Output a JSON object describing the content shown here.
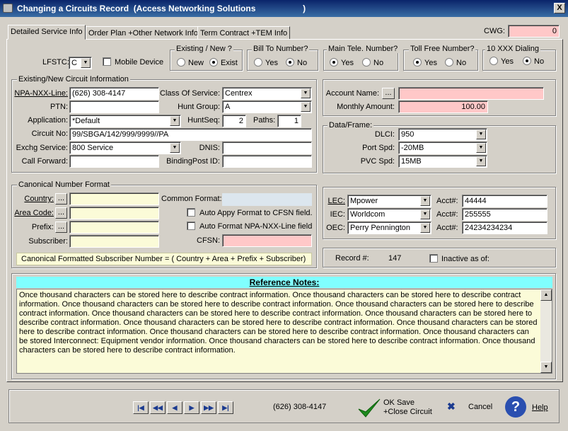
{
  "window": {
    "title": "Changing a Circuits Record  (Access Networking Solutions                    )",
    "close_label": "X"
  },
  "tabs": [
    {
      "label": "Detailed Service Info"
    },
    {
      "label": "Order Plan +Other Network Info"
    },
    {
      "label": "Term Contract +TEM Info"
    }
  ],
  "cwg": {
    "label": "CWG:",
    "value": "0"
  },
  "lfstc": {
    "label": "LFSTC:",
    "value": "C"
  },
  "mobile_device": {
    "label": "Mobile Device",
    "checked": false
  },
  "existing_new": {
    "title": "Existing / New ?",
    "options": [
      "New",
      "Exist"
    ],
    "selected": "Exist"
  },
  "bill_to_number": {
    "title": "Bill To Number?",
    "options": [
      "Yes",
      "No"
    ],
    "selected": "No"
  },
  "main_tele": {
    "title": "Main Tele. Number?",
    "options": [
      "Yes",
      "No"
    ],
    "selected": "Yes"
  },
  "toll_free": {
    "title": "Toll Free Number?",
    "options": [
      "Yes",
      "No"
    ],
    "selected": "Yes"
  },
  "ten_xxx": {
    "title": "10 XXX Dialing",
    "options": [
      "Yes",
      "No"
    ],
    "selected": "No"
  },
  "circuit_info": {
    "title": "Existing/New Circuit Information",
    "npa_label": "NPA-NXX-Line:",
    "npa_value": "(626) 308-4147",
    "ptn_label": "PTN:",
    "ptn_value": "",
    "application_label": "Application:",
    "application_value": "*Default",
    "circuit_no_label": "Circuit No:",
    "circuit_no_value": "99/SBGA/142/999/9999//PA",
    "exchg_label": "Exchg Service:",
    "exchg_value": "800 Service",
    "call_forward_label": "Call Forward:",
    "call_forward_value": "",
    "class_label": "Class Of Service:",
    "class_value": "Centrex",
    "hunt_group_label": "Hunt Group:",
    "hunt_group_value": "A",
    "huntseq_label": "HuntSeq:",
    "huntseq_value": "2",
    "paths_label": "Paths:",
    "paths_value": "1",
    "dnis_label": "DNIS:",
    "dnis_value": "",
    "bindingpost_label": "BindingPost ID:",
    "bindingpost_value": ""
  },
  "account": {
    "name_label": "Account Name:",
    "name_value": "",
    "monthly_label": "Monthly Amount:",
    "monthly_value": "100.00",
    "browse_label": "..."
  },
  "data_frame": {
    "title": "Data/Frame:",
    "dlci_label": "DLCI:",
    "dlci_value": "950",
    "port_label": "Port Spd:",
    "port_value": "-20MB",
    "pvc_label": "PVC Spd:",
    "pvc_value": "15MB"
  },
  "canonical": {
    "title": "Canonical Number Format",
    "country_label": "Country:",
    "area_label": "Area Code:",
    "prefix_label": "Prefix:",
    "subscriber_label": "Subscriber:",
    "common_format_label": "Common Format:",
    "auto_apply_label": "Auto Appy Format to CFSN field.",
    "auto_format_label": "Auto Format NPA-NXX-Line field",
    "cfsn_label": "CFSN:",
    "formula": "Canonical Formatted Subscriber Number =  ( Country + Area + Prefix + Subscriber)",
    "browse_label": "..."
  },
  "carriers": {
    "lec_label": "LEC:",
    "lec_value": "Mpower",
    "lec_acct_label": "Acct#:",
    "lec_acct": "44444",
    "iec_label": "IEC:",
    "iec_value": "Worldcom",
    "iec_acct_label": "Acct#:",
    "iec_acct": "255555",
    "oec_label": "OEC:",
    "oec_value": "Perry Pennington",
    "oec_acct_label": "Acct#:",
    "oec_acct": "24234234234"
  },
  "record": {
    "label": "Record #:",
    "value": "147",
    "inactive_label": "Inactive as of:"
  },
  "notes": {
    "heading": "Reference Notes:",
    "text": "Once thousand characters can be stored here to describe contract information. Once thousand characters can be stored here to describe contract information. Once thousand characters can be stored here to describe contract information. Once thousand characters can be stored here to describe contract information. Once thousand characters can be stored here to describe contract information. Once thousand characters can be stored here to describe contract information. Once thousand characters can be stored here to describe contract information. Once thousand characters can be stored here to describe contract information. Once thousand characters can be stored here to describe contract information. Once thousand characters can be stored Interconnect: Equipment vendor information. Once thousand characters can be stored here to describe contract information. Once thousand characters can be stored here to describe contract information."
  },
  "footer": {
    "nav": [
      "first-icon",
      "prev-page-icon",
      "prev-icon",
      "next-icon",
      "next-page-icon",
      "last-icon"
    ],
    "phone": "(626) 308-4147",
    "ok_line1": "OK Save",
    "ok_line2": "+Close Circuit",
    "cancel": "Cancel",
    "help": "Help"
  },
  "colors": {
    "pink_field": "#ffc8c8",
    "cream_field": "#fbfbd8",
    "notes_header": "#80ffff",
    "title_bar": "#0a246a"
  }
}
